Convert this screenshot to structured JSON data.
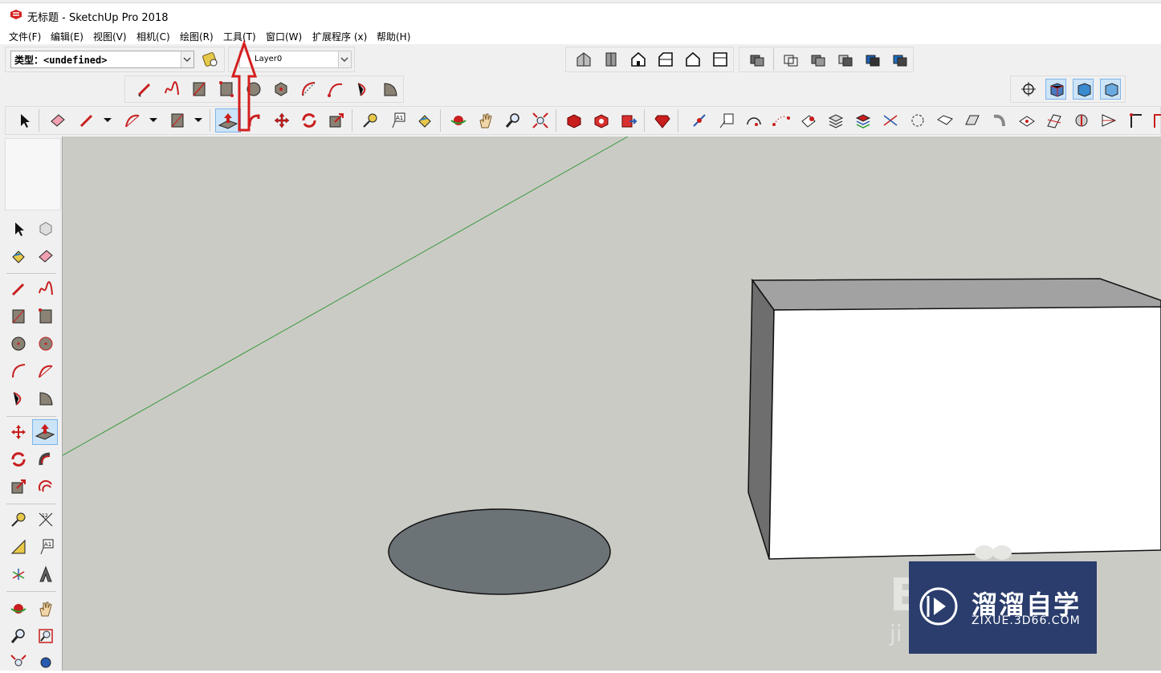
{
  "window": {
    "title": "无标题 - SketchUp Pro 2018"
  },
  "menu": {
    "file": "文件(F)",
    "edit": "编辑(E)",
    "view": "视图(V)",
    "camera": "相机(C)",
    "draw": "绘图(R)",
    "tools": "工具(T)",
    "window": "窗口(W)",
    "extensions": "扩展程序 (x)",
    "help": "帮助(H)"
  },
  "toolbar": {
    "type_label": "类型：<undefined>",
    "layer_value": "Layer0"
  },
  "watermark": {
    "brand": "溜溜自学",
    "url": "ZIXUE.3D66.COM"
  },
  "colors": {
    "accent_red": "#d42020",
    "watermark_bg": "#2a3d6c",
    "viewport_bg": "#cbcbc6",
    "green_axis": "#3a9a3a",
    "selected_tool": "#cce4f7"
  },
  "icons": [
    "app-logo-icon",
    "select-icon",
    "eraser-icon",
    "pencil-icon",
    "arc-icon",
    "rectangle-icon",
    "push-pull-icon",
    "follow-me-icon",
    "move-icon",
    "rotate-icon",
    "scale-icon",
    "tape-measure-icon",
    "text-icon",
    "paint-bucket-icon",
    "orbit-icon",
    "pan-icon",
    "zoom-icon",
    "zoom-extents-icon",
    "3d-warehouse-icon",
    "extension-warehouse-icon",
    "layout-icon",
    "ruby-icon",
    "house-icon",
    "shadow-icon",
    "style-icon",
    "up-arrow-annotation-icon"
  ]
}
